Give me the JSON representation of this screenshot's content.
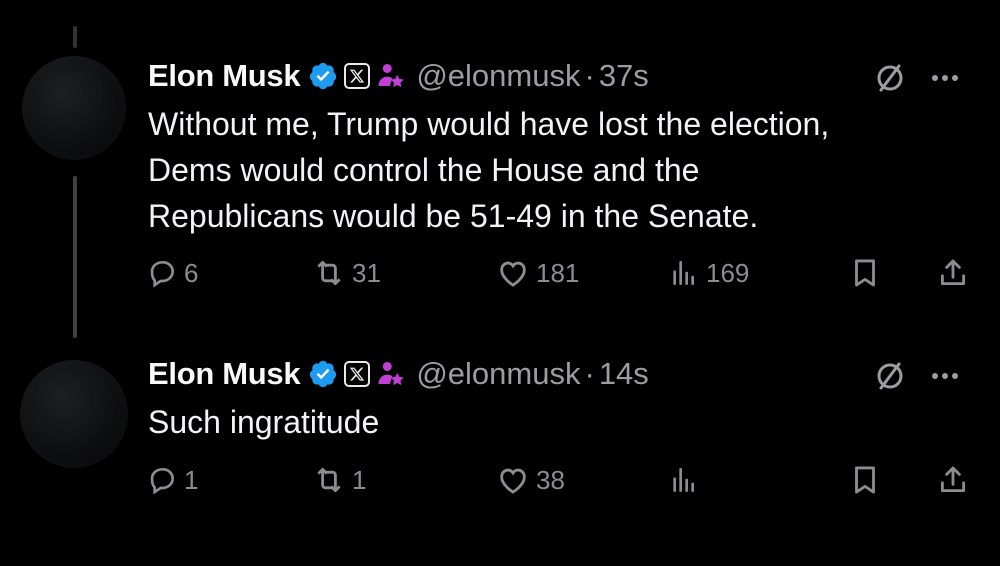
{
  "tweets": [
    {
      "display_name": "Elon Musk",
      "handle": "@elonmusk",
      "separator": "·",
      "time": "37s",
      "text_lines": [
        "Without me, Trump would have lost the election,",
        "Dems would control the House and the",
        "Republicans would be 51-49 in the Senate."
      ],
      "replies": "6",
      "reposts": "31",
      "likes": "181",
      "views": "169"
    },
    {
      "display_name": "Elon Musk",
      "handle": "@elonmusk",
      "separator": "·",
      "time": "14s",
      "text_lines": [
        "Such ingratitude"
      ],
      "replies": "1",
      "reposts": "1",
      "likes": "38",
      "views": ""
    }
  ],
  "colors": {
    "verified": "#1d9bf0",
    "affiliate": "#c23fd6",
    "muted": "#8a8e92"
  },
  "icons": {
    "verified": "verified-badge-icon",
    "x_logo": "x-logo-icon",
    "affiliate": "affiliate-person-icon",
    "grok": "grok-icon",
    "more": "more-dots-icon",
    "reply": "reply-icon",
    "repost": "repost-icon",
    "like": "like-icon",
    "views": "views-icon",
    "bookmark": "bookmark-icon",
    "share": "share-icon"
  }
}
